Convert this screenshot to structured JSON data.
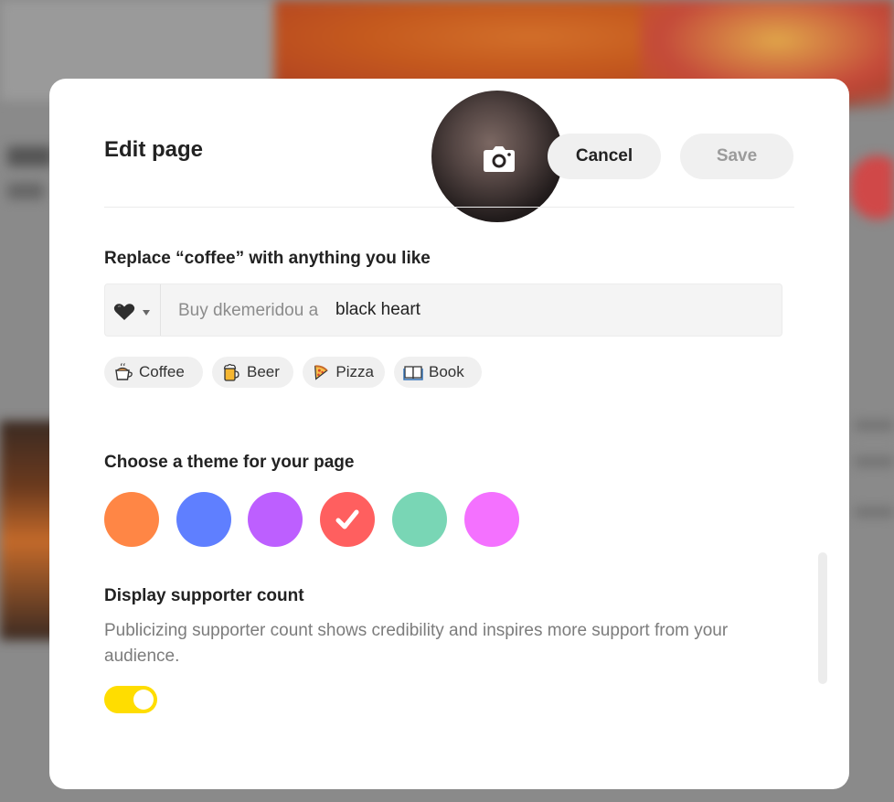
{
  "modal": {
    "title": "Edit page",
    "cancel_label": "Cancel",
    "save_label": "Save"
  },
  "replace": {
    "heading": "Replace “coffee” with anything you like",
    "selected_emoji": "black-heart-icon",
    "prefix": "Buy dkemeridou a",
    "value": "black heart",
    "suggestions": [
      {
        "label": "Coffee",
        "icon": "coffee-icon"
      },
      {
        "label": "Beer",
        "icon": "beer-icon"
      },
      {
        "label": "Pizza",
        "icon": "pizza-icon"
      },
      {
        "label": "Book",
        "icon": "book-icon"
      }
    ]
  },
  "theme": {
    "heading": "Choose a theme for your page",
    "colors": [
      "#FF8645",
      "#5F7FFF",
      "#BD5FFF",
      "#FF5F5F",
      "#79D6B5",
      "#F471FF"
    ],
    "selected_color": "#FF5F5F"
  },
  "supporter_count": {
    "heading": "Display supporter count",
    "description": "Publicizing supporter count shows credibility and inspires more support from your audience.",
    "enabled": true
  },
  "colors": {
    "toggle_on": "#FFDD00",
    "button_bg": "#F0F0F0"
  }
}
